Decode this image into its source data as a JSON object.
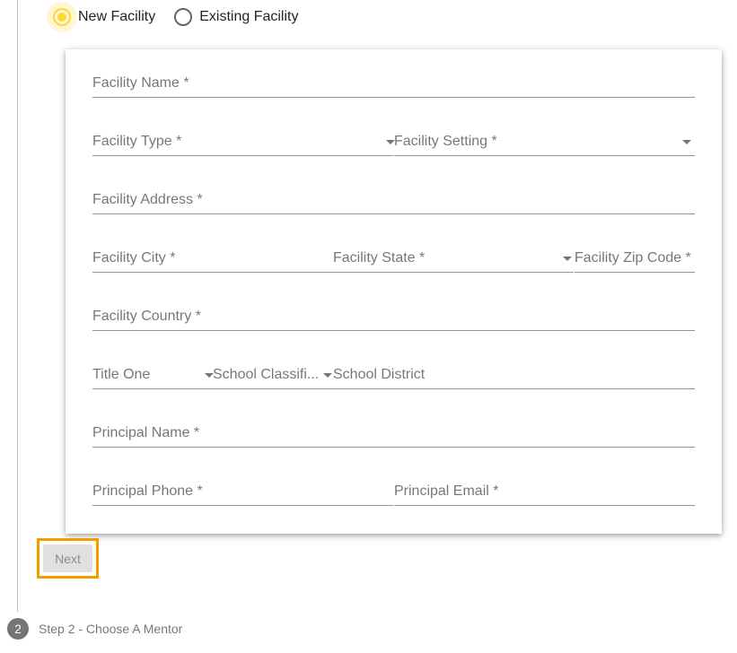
{
  "facility_choice": {
    "options": [
      {
        "label": "New Facility",
        "checked": true
      },
      {
        "label": "Existing Facility",
        "checked": false
      }
    ]
  },
  "form": {
    "facility_name": "Facility Name *",
    "facility_type": "Facility Type *",
    "facility_setting": "Facility Setting *",
    "facility_address": "Facility Address *",
    "facility_city": "Facility City *",
    "facility_state": "Facility State *",
    "facility_zip": "Facility Zip Code *",
    "facility_country": "Facility Country *",
    "title_one": "Title One",
    "school_classification": "School Classifi...",
    "school_district": "School District",
    "principal_name": "Principal Name *",
    "principal_phone": "Principal Phone *",
    "principal_email": "Principal Email *"
  },
  "actions": {
    "next_label": "Next"
  },
  "stepper": {
    "next_step": {
      "number": "2",
      "label": "Step 2 - Choose A Mentor"
    }
  },
  "colors": {
    "accent": "#fdd835",
    "highlight": "#f59c00"
  }
}
